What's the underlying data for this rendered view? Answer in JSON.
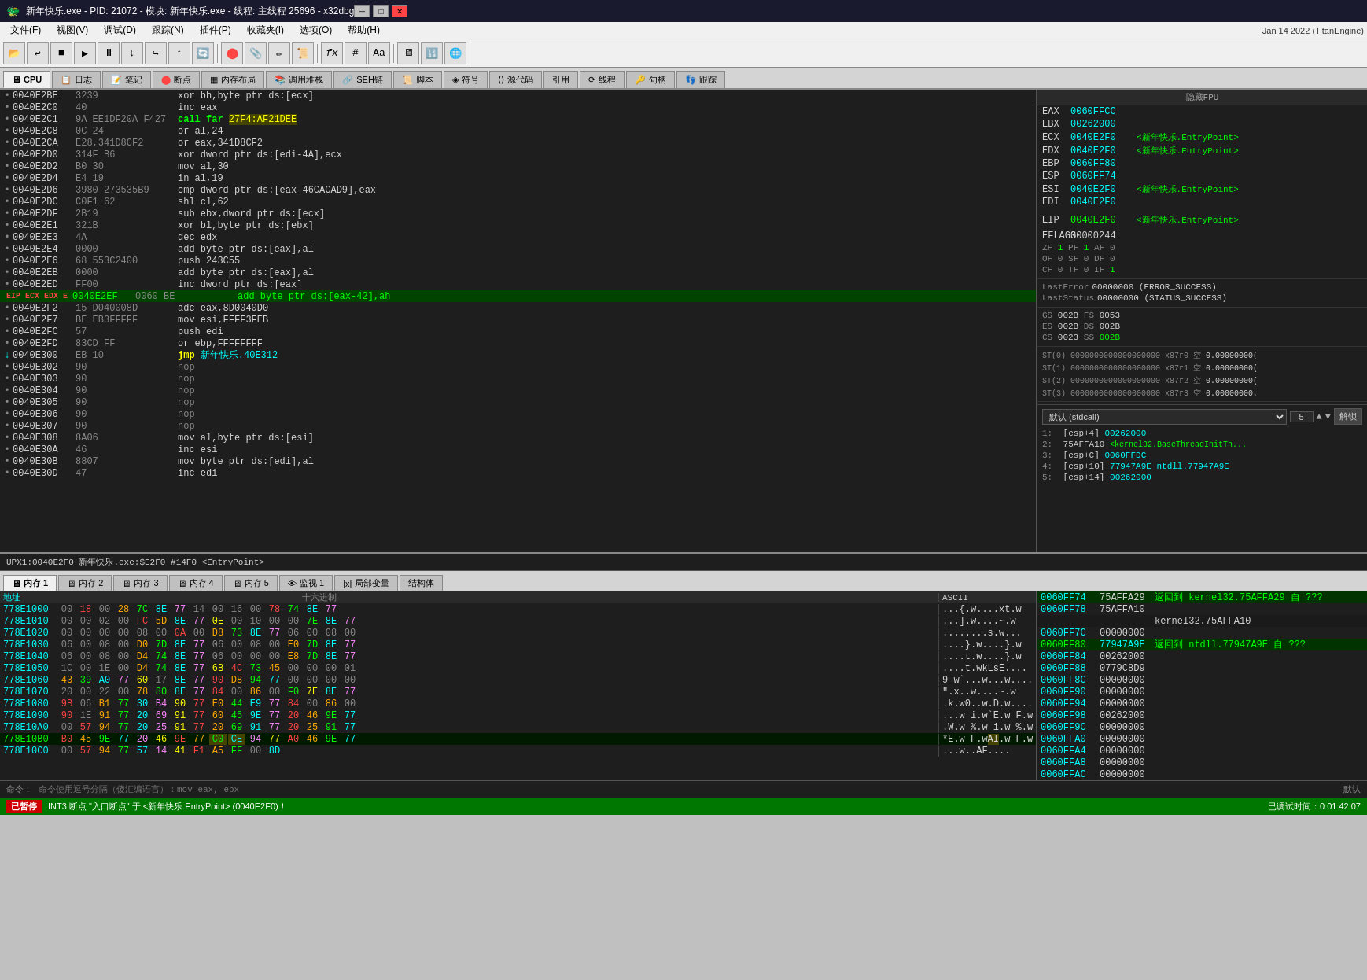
{
  "title_bar": {
    "text": "新年快乐.exe - PID: 21072 - 模块: 新年快乐.exe - 线程: 主线程 25696 - x32dbg",
    "min": "─",
    "max": "□",
    "close": "✕"
  },
  "menu": {
    "items": [
      "文件(F)",
      "视图(V)",
      "调试(D)",
      "跟踪(N)",
      "插件(P)",
      "收藏夹(I)",
      "选项(O)",
      "帮助(H)"
    ],
    "date": "Jan 14 2022 (TitanEngine)"
  },
  "tabs": {
    "items": [
      "CPU",
      "日志",
      "笔记",
      "断点",
      "内存布局",
      "调用堆栈",
      "SEH链",
      "脚本",
      "符号",
      "源代码",
      "引用",
      "线程",
      "句柄",
      "跟踪"
    ]
  },
  "registers": {
    "title": "隐藏FPU",
    "eax": "0060FFCC",
    "ebx": "00262000",
    "ecx": "0040E2F0",
    "ecx_comment": "<新年快乐.EntryPoint>",
    "edx": "0040E2F0",
    "edx_comment": "<新年快乐.EntryPoint>",
    "ebp": "0060FF80",
    "esp": "0060FF74",
    "esi": "0040E2F0",
    "esi_comment": "<新年快乐.EntryPoint>",
    "edi": "0040E2F0",
    "eip": "0040E2F0",
    "eip_comment": "<新年快乐.EntryPoint>",
    "eflags": "00000244",
    "zf": "1",
    "pf": "1",
    "af": "0",
    "of": "0",
    "sf": "0",
    "df": "0",
    "cf": "0",
    "tf": "0",
    "if_": "1",
    "lasterror": "00000000 (ERROR_SUCCESS)",
    "laststatus": "00000000 (STATUS_SUCCESS)",
    "gs": "002B",
    "fs": "0053",
    "es": "002B",
    "ds": "002B",
    "cs": "0023",
    "ss": "002B",
    "st0": "00000000000000000000 x87r0",
    "st1": "00000000000000000000 x87r1",
    "st2": "00000000000000000000 x87r2",
    "st3": "00000000000000000000 x87r3",
    "call_convention": "默认 (stdcall)",
    "call_num": "5",
    "unlock_label": "解锁",
    "stack_entries": [
      {
        "idx": "1:",
        "addr": "[esp+4]",
        "val": "00262000",
        "comment": ""
      },
      {
        "idx": "2:",
        "addr": "75AFFA10",
        "val": "<kernel32.BaseThreadInitTh...",
        "comment": ""
      },
      {
        "idx": "3:",
        "addr": "[esp+C]",
        "val": "0060FFDC",
        "comment": ""
      },
      {
        "idx": "4:",
        "addr": "[esp+10]",
        "val": "77947A9E ntdll.77947A9E",
        "comment": ""
      },
      {
        "idx": "5:",
        "addr": "[esp+14]",
        "val": "00262000",
        "comment": ""
      }
    ]
  },
  "disasm": {
    "lines": [
      {
        "addr": "0040E2BE",
        "bytes": "3239",
        "instr": "xor bh,byte ptr ds:[ecx]",
        "type": "normal",
        "bullet": "•"
      },
      {
        "addr": "0040E2C0",
        "bytes": "40",
        "instr": "inc eax",
        "type": "normal",
        "bullet": "•"
      },
      {
        "addr": "0040E2C1",
        "bytes": "9A EE1DF20A F427",
        "instr": "call far 27F4:AF21DEE",
        "type": "call_highlight",
        "bullet": "•"
      },
      {
        "addr": "0040E2C8",
        "bytes": "0C 24",
        "instr": "or al,24",
        "type": "normal",
        "bullet": "•"
      },
      {
        "addr": "0040E2CA",
        "bytes": "E28,341D8CF2",
        "instr": "or eax,341D8CF2",
        "type": "normal",
        "bullet": "•"
      },
      {
        "addr": "0040E2D0",
        "bytes": "314F B6",
        "instr": "xor dword ptr ds:[edi-4A],ecx",
        "type": "normal",
        "bullet": "•"
      },
      {
        "addr": "0040E2D2",
        "bytes": "B0 30",
        "instr": "mov al,30",
        "type": "normal",
        "bullet": "•"
      },
      {
        "addr": "0040E2D4",
        "bytes": "E4 19",
        "instr": "in al,19",
        "type": "normal",
        "bullet": "•"
      },
      {
        "addr": "0040E2D6",
        "bytes": "3980 273535B9",
        "instr": "cmp dword ptr ds:[eax-46CACAD9],eax",
        "type": "normal",
        "bullet": "•"
      },
      {
        "addr": "0040E2DC",
        "bytes": "C0F1 62",
        "instr": "shl cl,62",
        "type": "normal",
        "bullet": "•"
      },
      {
        "addr": "0040E2DF",
        "bytes": "2B19",
        "instr": "sub ebx,dword ptr ds:[ecx]",
        "type": "normal",
        "bullet": "•"
      },
      {
        "addr": "0040E2E1",
        "bytes": "321B",
        "instr": "xor bl,byte ptr ds:[ebx]",
        "type": "normal",
        "bullet": "•"
      },
      {
        "addr": "0040E2E3",
        "bytes": "4A",
        "instr": "dec edx",
        "type": "normal",
        "bullet": "•"
      },
      {
        "addr": "0040E2E4",
        "bytes": "0000",
        "instr": "add byte ptr ds:[eax],al",
        "type": "normal",
        "bullet": "•"
      },
      {
        "addr": "0040E2E6",
        "bytes": "68 553C2400",
        "instr": "push 243C55",
        "type": "normal",
        "bullet": "•"
      },
      {
        "addr": "0040E2EB",
        "bytes": "0000",
        "instr": "add byte ptr ds:[eax],al",
        "type": "normal",
        "bullet": "•"
      },
      {
        "addr": "0040E2ED",
        "bytes": "FF00",
        "instr": "inc dword ptr ds:[eax]",
        "type": "normal",
        "bullet": "•"
      },
      {
        "addr": "0040E2EF",
        "bytes": "0060 BE",
        "instr": "add byte ptr ds:[eax-42],ah",
        "type": "eip",
        "bullet": "EIP ECX EDX E"
      },
      {
        "addr": "0040E2F2",
        "bytes": "15 D040008D",
        "instr": "adc eax,8D0040D0",
        "type": "normal",
        "bullet": "•"
      },
      {
        "addr": "0040E2F7",
        "bytes": "BE EB3FFFFF",
        "instr": "mov esi,FFFF3FEB",
        "type": "normal",
        "bullet": "•"
      },
      {
        "addr": "0040E2FC",
        "bytes": "57",
        "instr": "push edi",
        "type": "normal",
        "bullet": "•"
      },
      {
        "addr": "0040E2FD",
        "bytes": "83CD FF",
        "instr": "or ebp,FFFFFFFF",
        "type": "normal",
        "bullet": "•"
      },
      {
        "addr": "0040E300",
        "bytes": "EB 10",
        "instr": "jmp 新年快乐.40E312",
        "type": "jmp",
        "bullet": "•",
        "arrow": true
      },
      {
        "addr": "0040E302",
        "bytes": "90",
        "instr": "nop",
        "type": "normal",
        "bullet": "•"
      },
      {
        "addr": "0040E303",
        "bytes": "90",
        "instr": "nop",
        "type": "normal",
        "bullet": "•"
      },
      {
        "addr": "0040E304",
        "bytes": "90",
        "instr": "nop",
        "type": "normal",
        "bullet": "•"
      },
      {
        "addr": "0040E305",
        "bytes": "90",
        "instr": "nop",
        "type": "normal",
        "bullet": "•"
      },
      {
        "addr": "0040E306",
        "bytes": "90",
        "instr": "nop",
        "type": "normal",
        "bullet": "•"
      },
      {
        "addr": "0040E307",
        "bytes": "90",
        "instr": "nop",
        "type": "normal",
        "bullet": "•"
      },
      {
        "addr": "0040E308",
        "bytes": "8A06",
        "instr": "mov al,byte ptr ds:[esi]",
        "type": "normal",
        "bullet": "•"
      },
      {
        "addr": "0040E30A",
        "bytes": "46",
        "instr": "inc esi",
        "type": "normal",
        "bullet": "•"
      },
      {
        "addr": "0040E30B",
        "bytes": "8807",
        "instr": "mov byte ptr ds:[edi],al",
        "type": "normal",
        "bullet": "•"
      },
      {
        "addr": "0040E30D",
        "bytes": "47",
        "instr": "inc edi",
        "type": "normal",
        "bullet": "•"
      }
    ]
  },
  "status_middle": "UPX1:0040E2F0 新年快乐.exe:$E2F0 #14F0 <EntryPoint>",
  "memory_tabs": [
    "内存 1",
    "内存 2",
    "内存 3",
    "内存 4",
    "内存 5",
    "监视 1",
    "局部变量",
    "结构体"
  ],
  "hex_data": {
    "lines": [
      {
        "addr": "778E1000",
        "bytes": [
          "00",
          "18",
          "00",
          "28",
          "7C",
          "8E",
          "77",
          "14",
          "00",
          "16",
          "00",
          "78",
          "74",
          "8E",
          "77"
        ],
        "ascii": "...{.w....xt.w"
      },
      {
        "addr": "778E1010",
        "bytes": [
          "00",
          "00",
          "02",
          "00",
          "FC",
          "5D",
          "8E",
          "77",
          "0E",
          "00",
          "10",
          "00",
          "00",
          "7E",
          "8E",
          "77"
        ],
        "ascii": "...].w....~.w"
      },
      {
        "addr": "778E1020",
        "bytes": [
          "00",
          "00",
          "00",
          "00",
          "08",
          "00",
          "0A",
          "00",
          "D8",
          "73",
          "8E",
          "77",
          "06",
          "00",
          "08",
          "00"
        ],
        "ascii": "........s.w..."
      },
      {
        "addr": "778E1030",
        "bytes": [
          "06",
          "00",
          "08",
          "00",
          "D0",
          "7D",
          "8E",
          "77",
          "06",
          "00",
          "08",
          "00",
          "E0",
          "7D",
          "8E",
          "77"
        ],
        "ascii": "....}.w....}.w"
      },
      {
        "addr": "778E1040",
        "bytes": [
          "06",
          "00",
          "08",
          "00",
          "D4",
          "74",
          "8E",
          "77",
          "06",
          "00",
          "00",
          "00",
          "E8",
          "7D",
          "8E",
          "77"
        ],
        "ascii": "....t.w....}.w"
      },
      {
        "addr": "778E1050",
        "bytes": [
          "1C",
          "00",
          "1E",
          "00",
          "D4",
          "74",
          "8E",
          "77",
          "6B",
          "4C",
          "73",
          "45",
          "00",
          "00",
          "00",
          "01"
        ],
        "ascii": "....t.wkLsE...."
      },
      {
        "addr": "778E1060",
        "bytes": [
          "43",
          "39",
          "A0",
          "77",
          "60",
          "17",
          "8E",
          "77",
          "90",
          "D8",
          "94",
          "77",
          "00",
          "00",
          "00",
          "00"
        ],
        "ascii": "9.w`...w...w...."
      },
      {
        "addr": "778E1070",
        "bytes": [
          "20",
          "00",
          "22",
          "00",
          "78",
          "80",
          "8E",
          "77",
          "84",
          "00",
          "86",
          "00",
          "F0",
          "7E",
          "8E",
          "77"
        ],
        "ascii": ".\"x..w....~.w"
      },
      {
        "addr": "778E1080",
        "bytes": [
          "9B",
          "06",
          "B1",
          "77",
          "30",
          "B4",
          "90",
          "77",
          "E0",
          "44",
          "E9",
          "77",
          "84",
          "00",
          "86",
          "00"
        ],
        "ascii": "...w0..w.D.w...."
      },
      {
        "addr": "778E1090",
        "bytes": [
          "90",
          "1E",
          "91",
          "77",
          "20",
          "69",
          "91",
          "77",
          "60",
          "45",
          "9E",
          "77",
          "20",
          "46",
          "9E",
          "77"
        ],
        "ascii": "...w i.w`E.w F.w"
      },
      {
        "addr": "778E10A0",
        "bytes": [
          "00",
          "57",
          "94",
          "77",
          "20",
          "25",
          "91",
          "77",
          "20",
          "69",
          "91",
          "77",
          "20",
          "25",
          "91",
          "77"
        ],
        "ascii": ".W.w %.w i.w %.w"
      },
      {
        "addr": "778E10B0",
        "bytes": [
          "B0",
          "45",
          "9E",
          "77",
          "20",
          "46",
          "9E",
          "77",
          "C0",
          "CE",
          "94",
          "77",
          "A0",
          "46",
          "9E",
          "77"
        ],
        "ascii": "*E.w F.wAI.w F.w"
      },
      {
        "addr": "778E10C0",
        "bytes": [
          "00",
          "57",
          "94",
          "77",
          "57",
          "14",
          "41",
          "F1",
          "A5",
          "FF",
          "00",
          "8D"
        ],
        "ascii": "...w..AF...."
      }
    ]
  },
  "stack_right": {
    "lines": [
      {
        "addr": "0060FF74",
        "val": "75AFFA29",
        "comment": "返回到 kernel32.75AFFA29 自 ???",
        "highlight": true
      },
      {
        "addr": "0060FF78",
        "val": "75AFFA10",
        "comment": "",
        "highlight": false
      },
      {
        "addr": "0060FF7C",
        "val": "00000000",
        "comment": "",
        "highlight": false
      },
      {
        "addr": "0060FF80",
        "val": "77947A9E",
        "comment": "返回到 ntdll.77947A9E 自 ???",
        "highlight": true
      },
      {
        "addr": "0060FF84",
        "val": "00262000",
        "comment": "",
        "highlight": false
      },
      {
        "addr": "0060FF88",
        "val": "0779C8D9",
        "comment": "",
        "highlight": false
      },
      {
        "addr": "0060FF8C",
        "val": "00000000",
        "comment": "",
        "highlight": false
      },
      {
        "addr": "0060FF90",
        "val": "00000000",
        "comment": "",
        "highlight": false
      },
      {
        "addr": "0060FF94",
        "val": "00000000",
        "comment": "",
        "highlight": false
      },
      {
        "addr": "0060FF98",
        "val": "00262000",
        "comment": "",
        "highlight": false
      },
      {
        "addr": "0060FF9C",
        "val": "00000000",
        "comment": "",
        "highlight": false
      },
      {
        "addr": "0060FFA0",
        "val": "00000000",
        "comment": "",
        "highlight": false
      },
      {
        "addr": "0060FFA4",
        "val": "00000000",
        "comment": "",
        "highlight": false
      },
      {
        "addr": "0060FFA8",
        "val": "00000000",
        "comment": "",
        "highlight": false
      },
      {
        "addr": "0060FFAC",
        "val": "00000000",
        "comment": "",
        "highlight": false
      }
    ],
    "comment_label": "kernel32.75AFFA10"
  },
  "cmd_bar": {
    "label": "命令：",
    "hint": "命令使用逗号分隔（傻汇编语言）：mov eax, ebx",
    "right": "默认"
  },
  "status_bar": {
    "stopped_label": "已暂停",
    "message": "INT3 断点 \"入口断点\" 于 <新年快乐.EntryPoint> (0040E2F0)！",
    "time": "已调试时间：0:01:42:07"
  }
}
